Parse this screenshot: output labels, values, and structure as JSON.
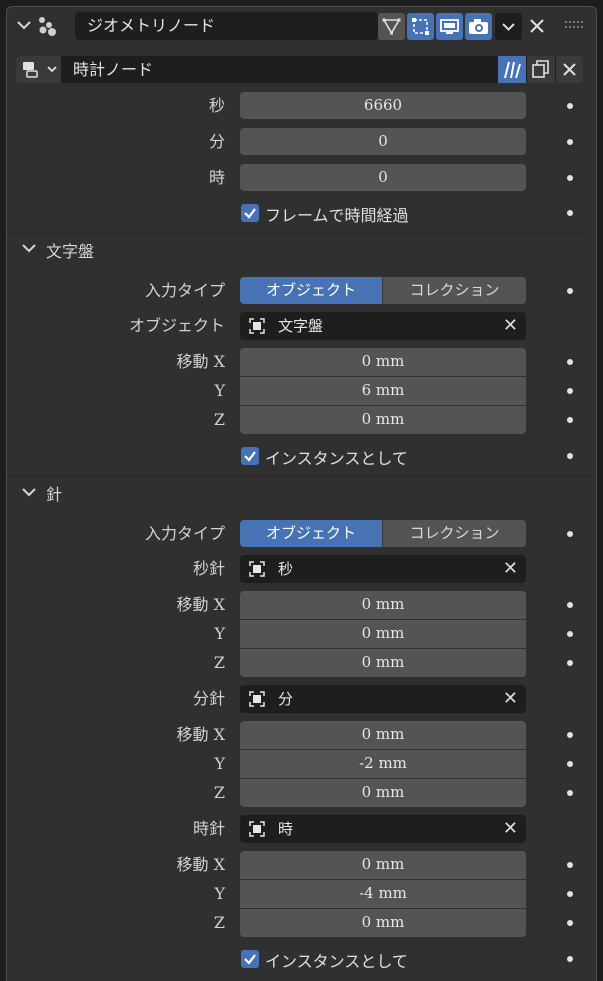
{
  "header": {
    "modifier_name": "ジオメトリノード",
    "node_group_name": "時計ノード"
  },
  "time": {
    "seconds_label": "秒",
    "seconds_value": "6660",
    "minutes_label": "分",
    "minutes_value": "0",
    "hours_label": "時",
    "hours_value": "0",
    "frame_elapsed_label": "フレームで時間経過"
  },
  "dial_section": {
    "title": "文字盤",
    "input_type_label": "入力タイプ",
    "option_object": "オブジェクト",
    "option_collection": "コレクション",
    "object_label": "オブジェクト",
    "object_value": "文字盤",
    "move_x_label": "移動 X",
    "x_value": "0 mm",
    "y_label": "Y",
    "y_value": "6 mm",
    "z_label": "Z",
    "z_value": "0 mm",
    "as_instance_label": "インスタンスとして"
  },
  "hands_section": {
    "title": "針",
    "input_type_label": "入力タイプ",
    "option_object": "オブジェクト",
    "option_collection": "コレクション",
    "second_hand_label": "秒針",
    "second_hand_value": "秒",
    "sec_x_label": "移動 X",
    "sec_x": "0 mm",
    "sec_y_label": "Y",
    "sec_y": "0 mm",
    "sec_z_label": "Z",
    "sec_z": "0 mm",
    "minute_hand_label": "分針",
    "minute_hand_value": "分",
    "min_x_label": "移動 X",
    "min_x": "0 mm",
    "min_y_label": "Y",
    "min_y": "-2 mm",
    "min_z_label": "Z",
    "min_z": "0 mm",
    "hour_hand_label": "時針",
    "hour_hand_value": "時",
    "hr_x_label": "移動 X",
    "hr_x": "0 mm",
    "hr_y_label": "Y",
    "hr_y": "-4 mm",
    "hr_z_label": "Z",
    "hr_z": "0 mm",
    "as_instance_label": "インスタンスとして"
  },
  "colors": {
    "accent": "#4772b3",
    "panel": "#303030",
    "field": "#545454"
  }
}
